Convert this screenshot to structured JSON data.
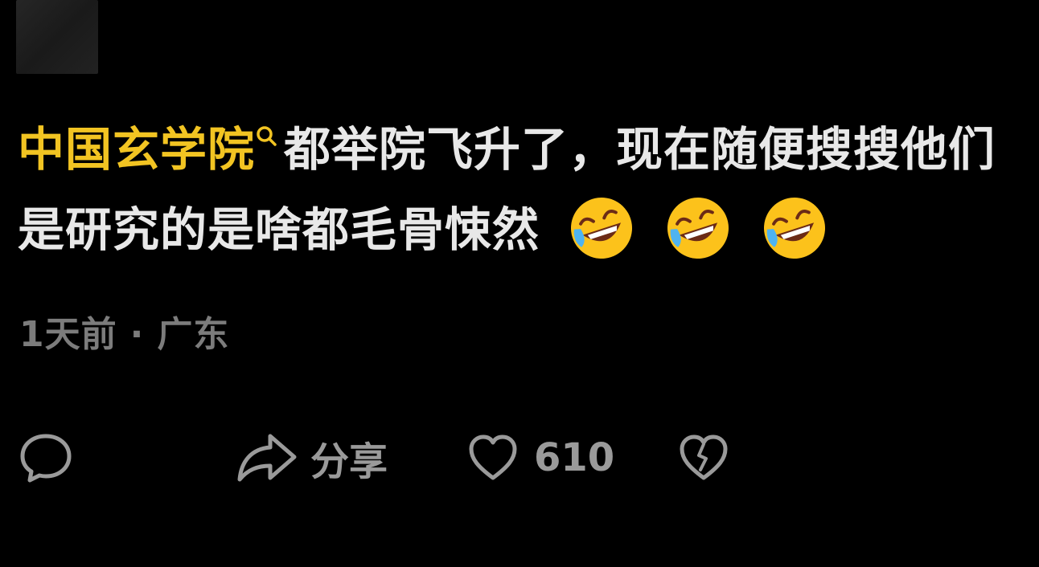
{
  "comment": {
    "keyword": "中国玄学院",
    "text": "都举院飞升了，现在随便搜搜他们是研究的是啥都毛骨悚然",
    "emojis": [
      "rolling-on-floor-laughing-icon",
      "rolling-on-floor-laughing-icon",
      "rolling-on-floor-laughing-icon"
    ],
    "keyword_color": "#f2c422"
  },
  "meta": {
    "time": "1天前",
    "separator": "·",
    "location": "广东"
  },
  "actions": {
    "reply_icon": "comment-bubble-icon",
    "share_icon": "share-arrow-icon",
    "share_label": "分享",
    "like_icon": "heart-icon",
    "like_count": "610",
    "dislike_icon": "broken-heart-icon"
  },
  "colors": {
    "background": "#000000",
    "text": "#e8e8e8",
    "muted": "#7c7c7c"
  }
}
